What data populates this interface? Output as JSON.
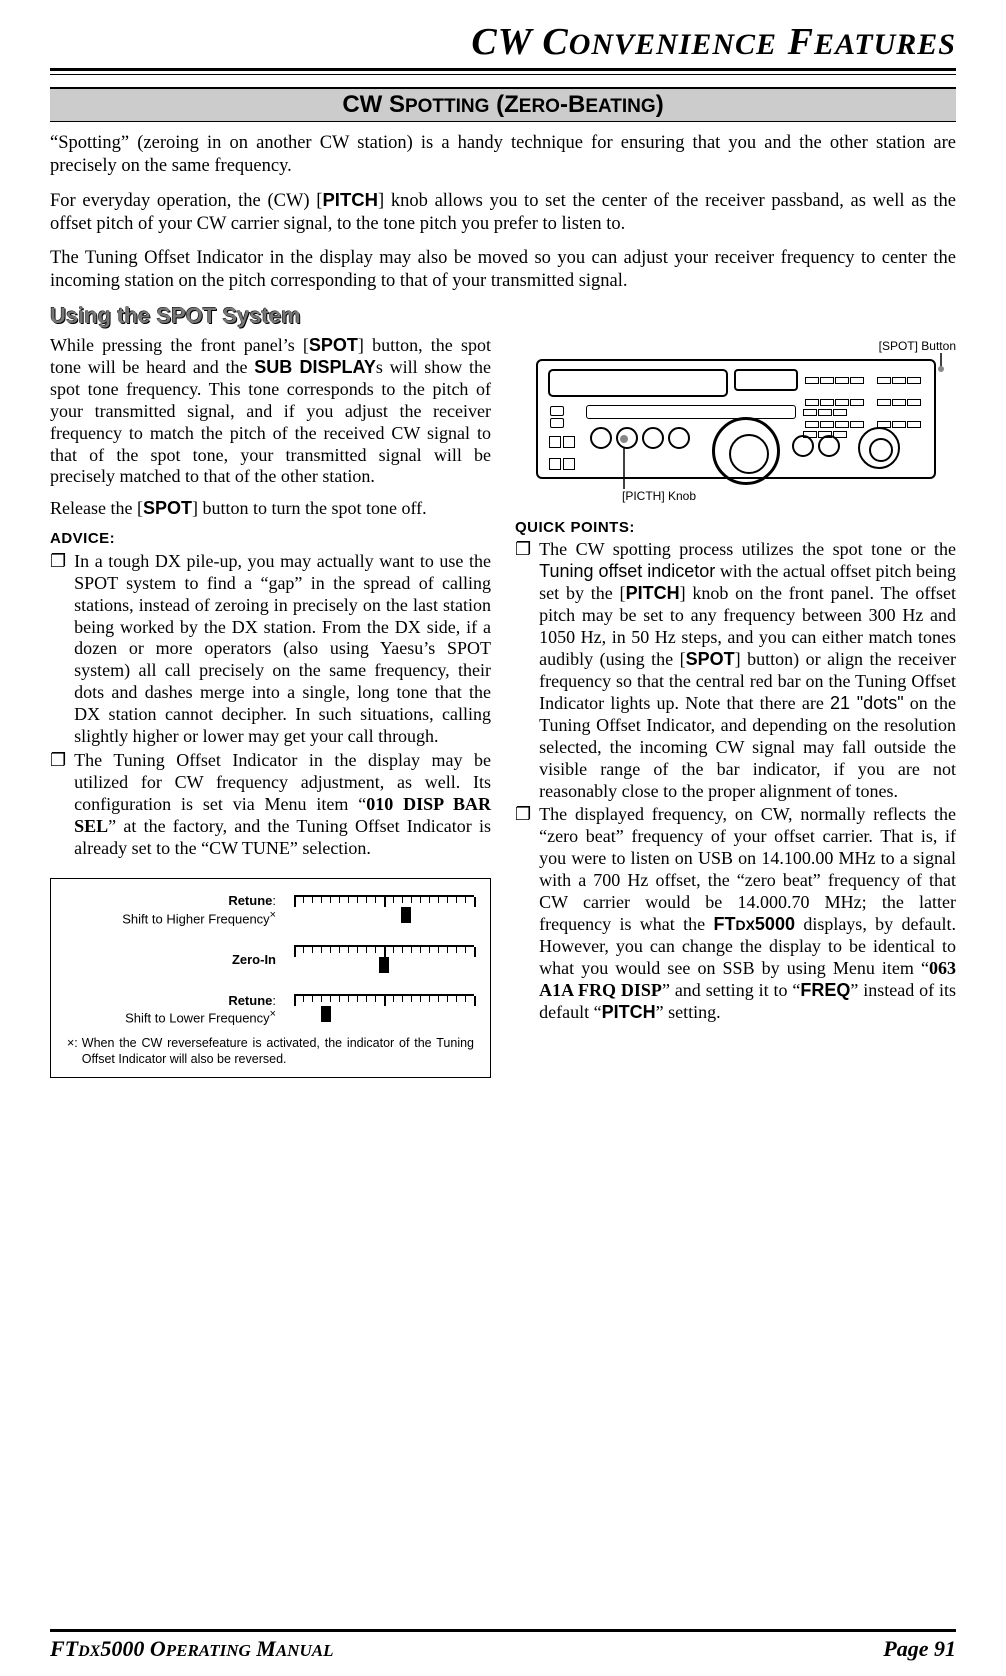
{
  "header": {
    "title_html": "CW Convenience Features"
  },
  "section_bar": "CW Spotting (Zero-Beating)",
  "intro": {
    "p1": "“Spotting” (zeroing in on another CW station) is a handy technique for ensuring that you and the other station are precisely on the same frequency.",
    "p2_a": "For everyday operation, the (CW) [",
    "p2_pitch": "PITCH",
    "p2_b": "] knob allows you to set the center of the receiver passband, as well as the offset pitch of your CW carrier signal, to the tone pitch you prefer to listen to.",
    "p3": "The Tuning Offset Indicator in the display may also be moved so you can adjust your receiver frequency to center the incoming station on the pitch corresponding to that of your transmitted signal."
  },
  "subhead": "Using the SPOT System",
  "left": {
    "para1_a": "While pressing the front panel’s [",
    "spot": "SPOT",
    "para1_b": "] button, the spot tone will be heard and the ",
    "subdisp": "SUB DISPLAY",
    "para1_c": "s will show the spot tone frequency. This tone corresponds to the pitch of your transmitted signal, and if you adjust the receiver frequency to match the pitch of the received CW signal to that of the spot tone, your transmitted signal will be precisely matched to that of the other station.",
    "para2_a": "Release the [",
    "para2_b": "] button to turn the spot tone off.",
    "advice_h": "ADVICE:",
    "b1": "In a tough DX pile-up, you may actually want to use the SPOT system to find a “gap” in the spread of calling stations, instead of zeroing in precisely on the last station being worked by the DX station. From the DX side, if a dozen or more operators (also using Yaesu’s SPOT system) all call precisely on the same frequency, their dots and dashes merge into a single, long tone that the DX station cannot decipher. In such situations, calling slightly higher or lower may get your call through.",
    "b2_a": "The Tuning Offset Indicator in the display may be utilized for CW frequency adjustment, as well. Its configuration is set via Menu item “",
    "b2_menu": "010 DISP BAR SEL",
    "b2_b": "” at the factory, and the Tuning Offset Indicator is already set to the “CW TUNE” selection.",
    "framed": {
      "r1a": "Retune",
      "r1b": "Shift to Higher Frequency",
      "zero": "Zero-In",
      "r3a": "Retune",
      "r3b": "Shift to Lower Frequency",
      "note_s": "×:",
      "note": "When the CW reversefeature is activated, the indicator of the Tuning Offset Indicator will also be reversed."
    }
  },
  "right": {
    "spot_callout": "[SPOT] Button",
    "pitch_callout": "[PICTH] Knob",
    "quick_h": "QUICK POINTS:",
    "q1_a": "The CW spotting process utilizes the spot tone or the ",
    "q1_toi": "Tuning offset indicetor",
    "q1_b": " with the actual offset pitch being set by the [",
    "q1_pitch": "PITCH",
    "q1_c": "] knob on the front panel. The offset pitch may be set to any frequency between 300 Hz and 1050 Hz, in 50 Hz steps, and you can either match tones audibly (using the [",
    "q1_spot": "SPOT",
    "q1_d": "] button) or align the receiver frequency so that the central red bar on the Tuning Offset Indicator lights up. Note that there are ",
    "q1_dots": "21 \"dots\"",
    "q1_e": " on the Tuning Offset Indicator, and depending on the resolution selected, the incoming CW signal may fall outside the visible range of the bar indicator, if you are not reasonably close to the proper alignment of tones.",
    "q2_a": "The displayed frequency, on CW, normally reflects the “zero beat” frequency of your offset carrier. That is, if you were to listen on USB on 14.100.00 MHz to a signal with a 700 Hz offset, the “zero beat” frequency of that CW carrier would be 14.000.70 MHz; the latter frequency is what the ",
    "q2_model": "FTDX5000",
    "q2_b": " displays, by default. However, you can change the display to be identical to what you would see on SSB by using Menu item “",
    "q2_menu": "063 A1A FRQ DISP",
    "q2_c": "” and setting it to “",
    "q2_freq": "FREQ",
    "q2_d": "” instead of its default “",
    "q2_pitch2": "PITCH",
    "q2_e": "” setting."
  },
  "footer": {
    "left_a": "FT",
    "left_b": "DX",
    "left_c": "5000 Operating Manual",
    "right": "Page 91"
  }
}
